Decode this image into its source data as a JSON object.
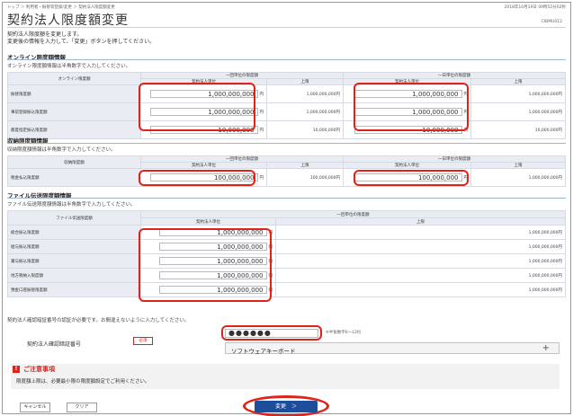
{
  "header": {
    "breadcrumb": "トップ ＞ 利用者・振替等登録/変更 ＞ 契約法人限度額変更",
    "timestamp": "2018年10月19日 09時52分02秒",
    "title": "契約法人限度額変更",
    "screen_id": "CIBMU012",
    "intro_1": "契約法人限度額を変更します。",
    "intro_2": "変更後の情報を入力して、「変更」ボタンを押してください。"
  },
  "online": {
    "section_title": "オンライン限度額情報",
    "note": "オンライン限度額情報は半角数字で入力してください。",
    "row_header": "オンライン限度額",
    "group1": "一回単位の限度額",
    "group2": "一日単位の限度額",
    "sub_contract": "契約法人単位",
    "sub_limit": "上限",
    "yen": "円",
    "rows": [
      {
        "label": "振替限度額",
        "v1": "1,000,000,000",
        "l1": "1,000,000,000円",
        "v2": "1,000,000,000",
        "l2": "1,000,000,000円"
      },
      {
        "label": "事前登録振込限度額",
        "v1": "1,000,000,000",
        "l1": "1,000,000,000円",
        "v2": "1,000,000,000",
        "l2": "1,000,000,000円"
      },
      {
        "label": "都度指定振込限度額",
        "v1": "10,000,000",
        "l1": "10,000,000円",
        "v2": "10,000,000",
        "l2": "10,000,000円"
      }
    ]
  },
  "receipt": {
    "section_title": "収納限度額情報",
    "note": "収納限度額情報は半角数字で入力してください。",
    "row_header": "収納限度額",
    "group1": "一回単位の限度額",
    "group2": "一日単位の限度額",
    "sub_contract": "契約法人単位",
    "sub_limit": "上限",
    "yen": "円",
    "rows": [
      {
        "label": "税金払込限度額",
        "v1": "100,000,000",
        "l1": "100,000,000円",
        "v2": "100,000,000",
        "l2": "1,000,000,000円"
      }
    ]
  },
  "file": {
    "section_title": "ファイル伝送限度額情報",
    "note": "ファイル伝送限度額情報は半角数字で入力してください。",
    "row_header": "ファイル伝送限度額",
    "group1": "一回単位の限度額",
    "sub_contract": "契約法人単位",
    "sub_limit": "上限",
    "yen": "円",
    "rows": [
      {
        "label": "総合振込限度額",
        "v1": "1,000,000,000",
        "l1": "1,000,000,000円"
      },
      {
        "label": "給与振込限度額",
        "v1": "1,000,000,000",
        "l1": "1,000,000,000円"
      },
      {
        "label": "賞与振込限度額",
        "v1": "1,000,000,000",
        "l1": "1,000,000,000円"
      },
      {
        "label": "地方税納入限度額",
        "v1": "1,000,000,000",
        "l1": "1,000,000,000円"
      },
      {
        "label": "預金口座振替限度額",
        "v1": "1,000,000,000",
        "l1": "1,000,000,000円"
      }
    ]
  },
  "auth": {
    "note": "契約法人確認暗証番号の認証が必要です。お間違えないように入力してください。",
    "label": "契約法人確認暗証番号",
    "required": "必須",
    "value": "●●●●●●",
    "hint": "※半角数字6～12桁",
    "keyboard": "ソフトウェアキーボード",
    "keyboard_icon": "+"
  },
  "caution": {
    "mark": "!",
    "title": "ご注意事項",
    "body": "限度額上限は、必要最小限の限度額設定でご利用ください。"
  },
  "buttons": {
    "cancel": "キャンセル",
    "clear": "クリア",
    "submit": "変更　＞"
  },
  "colors": {
    "highlight": "#e0231a",
    "primary_button": "#1d4e9a",
    "table_header": "#e9edf3"
  }
}
